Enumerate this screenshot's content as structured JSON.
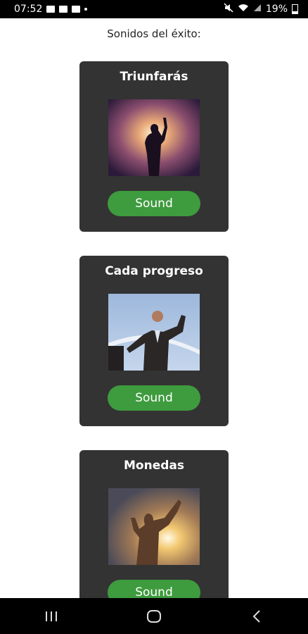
{
  "status_bar": {
    "time": "07:52",
    "battery": "19%"
  },
  "section_title": "Sonidos del éxito:",
  "cards": [
    {
      "title": "Triunfarás",
      "button_label": "Sound",
      "image": "silhouette-raised-fist"
    },
    {
      "title": "Cada progreso",
      "button_label": "Sound",
      "image": "businessman-finish-line"
    },
    {
      "title": "Monedas",
      "button_label": "Sound",
      "image": "woman-sunset-victory"
    }
  ],
  "nav": {
    "recents_icon": "recents-icon",
    "home_icon": "home-icon",
    "back_icon": "back-icon"
  }
}
